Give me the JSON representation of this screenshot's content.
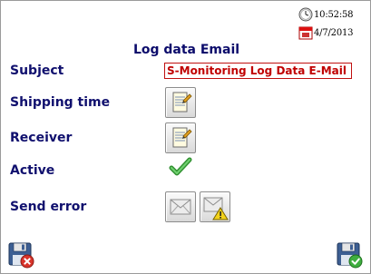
{
  "status": {
    "time": "10:52:58",
    "date": "4/7/2013"
  },
  "page": {
    "title": "Log data Email"
  },
  "fields": {
    "subject_label": "Subject",
    "subject_value": "S-Monitoring Log Data E-Mail",
    "shipping_label": "Shipping time",
    "receiver_label": "Receiver",
    "active_label": "Active",
    "active_checked": true,
    "send_error_label": "Send error"
  },
  "icons": {
    "clock": "clock-icon",
    "calendar": "calendar-icon",
    "shipping": "notepad-edit-icon",
    "receiver": "notepad-edit-icon",
    "active": "checkmark-icon",
    "send_error_mail": "envelope-icon",
    "send_error_warning": "envelope-warning-icon",
    "cancel": "save-cancel-icon",
    "confirm": "save-confirm-icon"
  },
  "colors": {
    "label": "#10106e",
    "subject_text": "#c00000",
    "subject_border": "#c01010",
    "check": "#3aa63a"
  }
}
